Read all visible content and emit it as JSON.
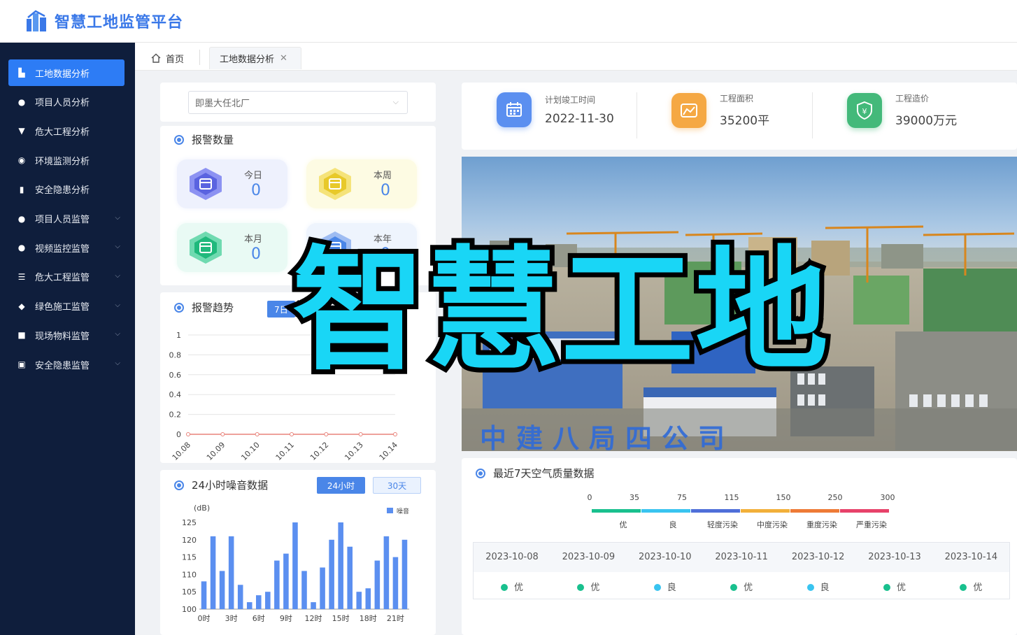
{
  "app": {
    "title": "智慧工地监管平台"
  },
  "sidebar": {
    "items": [
      {
        "label": "工地数据分析",
        "icon": "building-icon",
        "active": true,
        "expandable": false
      },
      {
        "label": "项目人员分析",
        "icon": "person-icon",
        "active": false,
        "expandable": false
      },
      {
        "label": "危大工程分析",
        "icon": "funnel-icon",
        "active": false,
        "expandable": false
      },
      {
        "label": "环境监测分析",
        "icon": "leaf-icon",
        "active": false,
        "expandable": false
      },
      {
        "label": "安全隐患分析",
        "icon": "bar-icon",
        "active": false,
        "expandable": false
      },
      {
        "label": "项目人员监管",
        "icon": "users-icon",
        "active": false,
        "expandable": true
      },
      {
        "label": "视频监控监管",
        "icon": "camera-icon",
        "active": false,
        "expandable": true
      },
      {
        "label": "危大工程监管",
        "icon": "stack-icon",
        "active": false,
        "expandable": true
      },
      {
        "label": "绿色施工监管",
        "icon": "shield-icon",
        "active": false,
        "expandable": true
      },
      {
        "label": "现场物料监管",
        "icon": "truck-icon",
        "active": false,
        "expandable": true
      },
      {
        "label": "安全隐患监管",
        "icon": "lock-icon",
        "active": false,
        "expandable": true
      }
    ]
  },
  "tabs": {
    "home": "首页",
    "active": "工地数据分析"
  },
  "site_select": {
    "value": "即墨大任北厂"
  },
  "alarm_count": {
    "title": "报警数量",
    "boxes": [
      {
        "label": "今日",
        "value": "0"
      },
      {
        "label": "本周",
        "value": "0"
      },
      {
        "label": "本月",
        "value": "0"
      },
      {
        "label": "本年",
        "value": "0"
      }
    ]
  },
  "alarm_trend": {
    "title": "报警趋势",
    "range_button": "7日",
    "chart_data": {
      "type": "line",
      "x": [
        "10.08",
        "10.09",
        "10.10",
        "10.11",
        "10.12",
        "10.13",
        "10.14"
      ],
      "y_ticks": [
        "0",
        "0.2",
        "0.4",
        "0.6",
        "0.8",
        "1"
      ],
      "ylim": [
        0,
        1
      ],
      "series": [
        {
          "values": [
            0,
            0,
            0,
            0,
            0,
            0,
            0
          ]
        }
      ],
      "color": "#e8827a"
    }
  },
  "noise": {
    "title": "24小时噪音数据",
    "btn_24h": "24小时",
    "btn_30d": "30天",
    "chart_data": {
      "type": "bar",
      "ylabel": "(dB)",
      "legend": "噪音",
      "ylim": [
        100,
        125
      ],
      "y_ticks": [
        "100",
        "105",
        "110",
        "115",
        "120",
        "125"
      ],
      "x_ticks": [
        "0时",
        "3时",
        "6时",
        "9时",
        "12时",
        "15时",
        "18时",
        "21时"
      ],
      "values": [
        108,
        121,
        111,
        121,
        107,
        102,
        104,
        105,
        114,
        116,
        125,
        111,
        102,
        112,
        120,
        125,
        118,
        105,
        106,
        114,
        121,
        115,
        120
      ],
      "color": "#5b8ff0"
    }
  },
  "info_cards": [
    {
      "label": "计划竣工时间",
      "value": "2022-11-30",
      "color": "#5b8ff0",
      "icon": "calendar-icon"
    },
    {
      "label": "工程面积",
      "value": "35200平",
      "color": "#f5a843",
      "icon": "area-chart-icon"
    },
    {
      "label": "工程造价",
      "value": "39000万元",
      "color": "#43b97a",
      "icon": "money-shield-icon"
    }
  ],
  "photo": {
    "caption": "中建八局四公司"
  },
  "air_quality": {
    "title": "最近7天空气质量数据",
    "scale_values": [
      "0",
      "35",
      "75",
      "115",
      "150",
      "250",
      "300"
    ],
    "levels": [
      {
        "label": "优",
        "color": "#19c08e"
      },
      {
        "label": "良",
        "color": "#39c4f0"
      },
      {
        "label": "轻度污染",
        "color": "#4f6fd9"
      },
      {
        "label": "中度污染",
        "color": "#f2b03a"
      },
      {
        "label": "重度污染",
        "color": "#ee7a36"
      },
      {
        "label": "严重污染",
        "color": "#e7426a"
      }
    ],
    "days": [
      {
        "date": "2023-10-08",
        "level": "优",
        "color": "#19c08e"
      },
      {
        "date": "2023-10-09",
        "level": "优",
        "color": "#19c08e"
      },
      {
        "date": "2023-10-10",
        "level": "良",
        "color": "#39c4f0"
      },
      {
        "date": "2023-10-11",
        "level": "优",
        "color": "#19c08e"
      },
      {
        "date": "2023-10-12",
        "level": "良",
        "color": "#39c4f0"
      },
      {
        "date": "2023-10-13",
        "level": "优",
        "color": "#19c08e"
      },
      {
        "date": "2023-10-14",
        "level": "优",
        "color": "#19c08e"
      }
    ]
  },
  "overlay": {
    "text": "智慧工地"
  }
}
